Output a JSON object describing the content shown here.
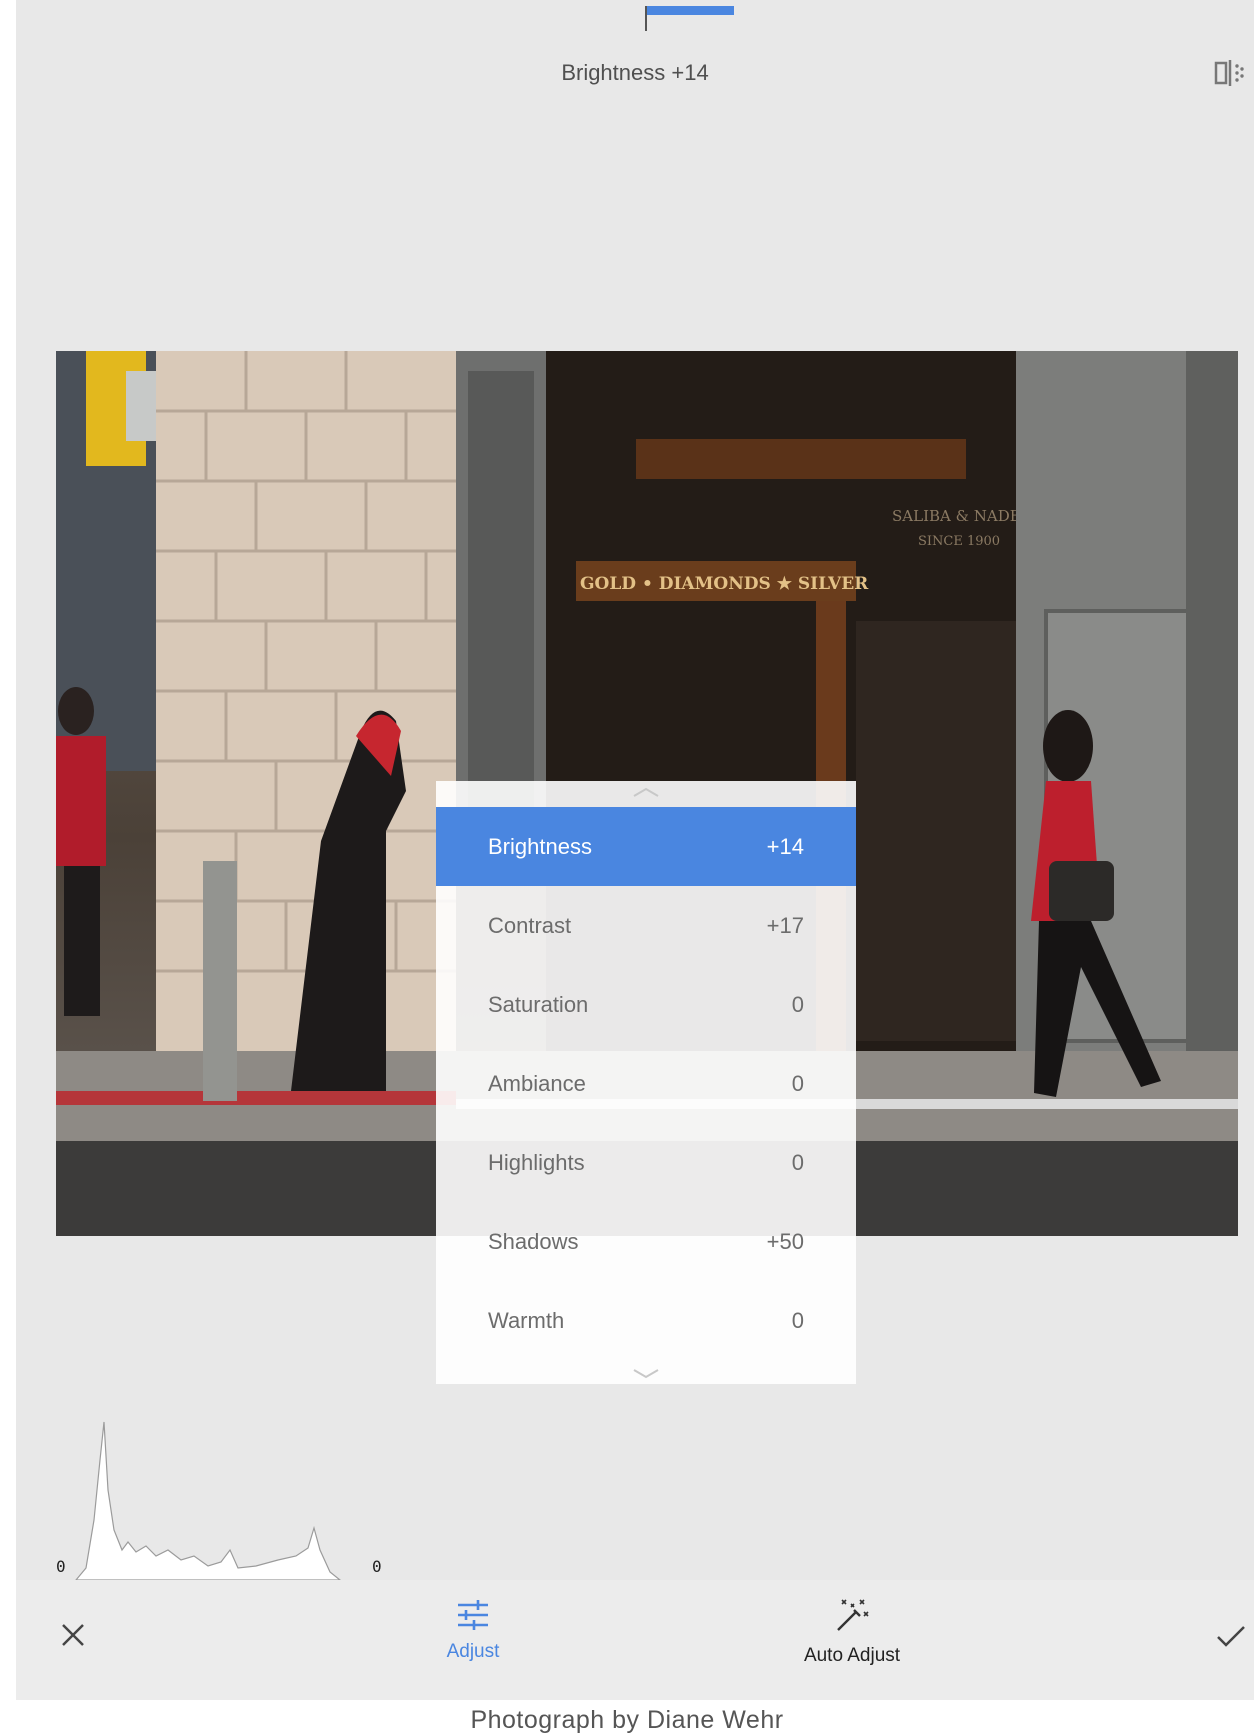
{
  "header": {
    "title": "Brightness +14"
  },
  "adjust_menu": {
    "items": [
      {
        "label": "Brightness",
        "value": "+14"
      },
      {
        "label": "Contrast",
        "value": "+17"
      },
      {
        "label": "Saturation",
        "value": "0"
      },
      {
        "label": "Ambiance",
        "value": "0"
      },
      {
        "label": "Highlights",
        "value": "0"
      },
      {
        "label": "Shadows",
        "value": "+50"
      },
      {
        "label": "Warmth",
        "value": "0"
      }
    ],
    "active_index": 0,
    "active_color": "#4a86e0"
  },
  "photo": {
    "sign_main": "GOLD • DIAMONDS ★ SILVER",
    "sign_store": "SALIBA & NADER",
    "sign_since": "SINCE 1900"
  },
  "histogram": {
    "left_label": "0",
    "right_label": "0"
  },
  "toolbar": {
    "cancel_icon": "close-icon",
    "adjust_label": "Adjust",
    "adjust_color": "#4a86e0",
    "auto_adjust_label": "Auto Adjust",
    "apply_icon": "check-icon"
  },
  "caption": "Photograph by Diane Wehr"
}
